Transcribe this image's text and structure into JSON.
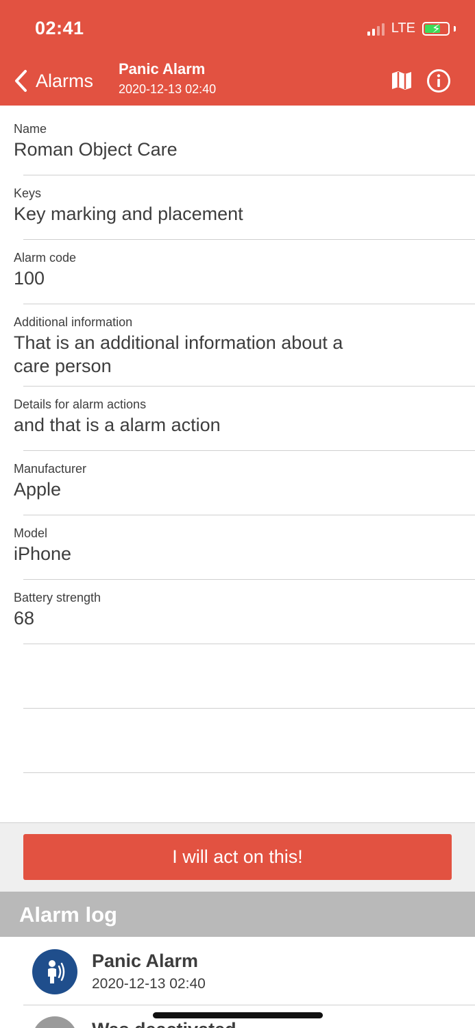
{
  "status_bar": {
    "time": "02:41",
    "network": "LTE"
  },
  "header": {
    "back_label": "Alarms",
    "title": "Panic Alarm",
    "subtitle": "2020-12-13 02:40",
    "icons": [
      "map-icon",
      "info-icon"
    ],
    "color": "#e25241"
  },
  "fields": [
    {
      "label": "Name",
      "value": "Roman Object Care"
    },
    {
      "label": "Keys",
      "value": "Key marking and placement"
    },
    {
      "label": "Alarm code",
      "value": "100"
    },
    {
      "label": "Additional information",
      "value": "That is an additional information about a care person"
    },
    {
      "label": "Details for alarm actions",
      "value": "and that is a alarm action"
    },
    {
      "label": "Manufacturer",
      "value": "Apple"
    },
    {
      "label": "Model",
      "value": "iPhone"
    },
    {
      "label": "Battery strength",
      "value": "68"
    }
  ],
  "action_button": {
    "label": "I will act on this!"
  },
  "alarm_log": {
    "title": "Alarm log",
    "items": [
      {
        "title": "Panic Alarm",
        "time": "2020-12-13 02:40",
        "icon": "panic-person-icon",
        "color": "#1f4e8c"
      },
      {
        "title": "Was deactivated",
        "time": "",
        "icon": "deactivated-icon",
        "color": "#9a9a9a"
      }
    ]
  }
}
